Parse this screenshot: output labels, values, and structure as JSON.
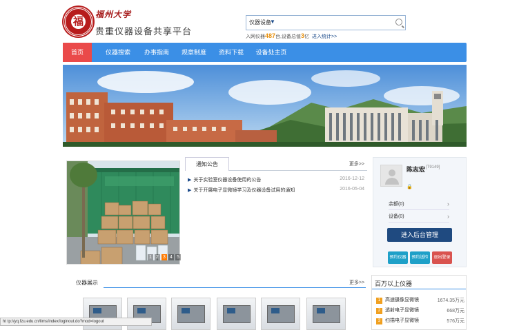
{
  "header": {
    "logo_char": "福",
    "site_name_cn": "福州大学",
    "site_title": "贵重仪器设备共享平台"
  },
  "search": {
    "category": "仪器设备",
    "placeholder": ""
  },
  "stats": {
    "prefix": "入网仪器",
    "count": "487",
    "middle": "台,设备总值",
    "value": "3",
    "suffix": "亿",
    "link": "进入统计>>"
  },
  "nav": {
    "items": [
      "首页",
      "仪器搜索",
      "办事指南",
      "规章制度",
      "资料下载",
      "设备处主页"
    ]
  },
  "slider": {
    "dots": [
      "1",
      "2",
      "3",
      "4",
      "5"
    ]
  },
  "notice": {
    "tab": "通知公告",
    "more": "更多>>",
    "items": [
      {
        "text": "关于实验室仪器设备使用的公告",
        "date": "2016-12-12"
      },
      {
        "text": "关于开展电子显微镜学习及仪器设备试用的通知",
        "date": "2016-05-04"
      }
    ]
  },
  "user": {
    "name": "陈志宏",
    "id": "[T9149]",
    "lock": "🔒",
    "rows": [
      "余额(0)",
      "设备(0)"
    ],
    "admin_button": "进入后台管理",
    "buttons": [
      "预约仪器",
      "预约送检",
      "退出登录"
    ]
  },
  "instruments": {
    "title": "仪器展示",
    "more": "更多>>"
  },
  "ranking": {
    "title": "百万以上仪器",
    "items": [
      {
        "rank": "1",
        "name": "高速摄像显微镜",
        "value": "1674.35万元"
      },
      {
        "rank": "2",
        "name": "透射电子显微镜",
        "value": "668万元"
      },
      {
        "rank": "3",
        "name": "扫描电子显微镜",
        "value": "576万元"
      }
    ]
  },
  "statusbar": {
    "text": "ht tp://yq.fzu.edu.cn/lims/index/loginout.do?mod=logout"
  },
  "colors": {
    "nav": "#3b8fe6",
    "nav_active": "#ea4a4a",
    "brand_red": "#b71c1c",
    "admin_button": "#1f4a80",
    "btn_teal": "#1ea0c8",
    "btn_red": "#d9534f"
  }
}
